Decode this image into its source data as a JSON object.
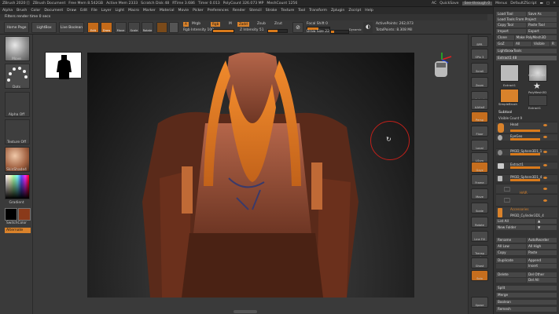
{
  "titlebar": {
    "items": [
      "ZBrush 2020 []",
      "ZBrush Document",
      "Free Mem 8.542GB",
      "Active Mem 2333",
      "Scratch Disk 48",
      "RTime 3.686",
      "Timer 0.013",
      "PolyCount 326.073 MP",
      "MeshCount 1256"
    ],
    "right": {
      "ac": "AC",
      "quicksave": "QuickSave",
      "seethrough": "See-through 0",
      "menus": "Menus",
      "script": "DefaultZScript"
    }
  },
  "menubar": [
    "Alpha",
    "Brush",
    "Color",
    "Document",
    "Draw",
    "Edit",
    "File",
    "Layer",
    "Light",
    "Macro",
    "Marker",
    "Material",
    "Movie",
    "Picker",
    "Preferences",
    "Render",
    "Stencil",
    "Stroke",
    "Texture",
    "Tool",
    "Transform",
    "Zplugin",
    "Zscript",
    "Help"
  ],
  "notebar": "Filters render time 0 secs",
  "toolbar": {
    "home_page": "Home Page",
    "lightbox": "LightBox",
    "live_boolean": "Live Boolean",
    "edit": "Edit",
    "draw": "Draw",
    "move": "Move",
    "scale": "Scale",
    "rotate": "Rotate",
    "a_label": "A",
    "mrgb": "Mrgb",
    "rgb": "Rgb",
    "m": "M",
    "zadd": "Zadd",
    "zsub": "Zsub",
    "zcut": "Zcut",
    "rgb_intensity_label": "Rgb Intensity",
    "rgb_intensity_value": "100",
    "z_intensity_label": "Z Intensity",
    "z_intensity_value": "51",
    "focal_shift_label": "Focal Shift",
    "focal_shift_value": "0",
    "draw_size_label": "Draw Size",
    "draw_size_value": "22",
    "dynamic": "Dynamic",
    "active_points_label": "ActivePoints:",
    "active_points_value": "262,073",
    "total_points_label": "TotalPoints:",
    "total_points_value": "8.308 Mil"
  },
  "left_shelf": {
    "brush_label": "Move",
    "stroke_label": "Dots",
    "alpha_label": "Alpha Off",
    "texture_label": "Texture Off",
    "material_label": "SkinShade4",
    "gradient_label": "Gradient",
    "switch_color_label": "SwitchColor",
    "alternate_label": "Alternate",
    "main_color": "#ffffff",
    "secondary_color": "#8a3a1a"
  },
  "right_shelf": [
    {
      "label": "BPR",
      "active": false
    },
    {
      "label": "SPix 3",
      "active": false
    },
    {
      "label": "Scroll",
      "active": false
    },
    {
      "label": "Zoom",
      "active": false
    },
    {
      "label": "Actual",
      "active": false
    },
    {
      "label": "AAHalf",
      "active": false
    },
    {
      "label": "Persp",
      "active": true
    },
    {
      "label": "Floor",
      "active": false
    },
    {
      "label": "Local",
      "active": false
    },
    {
      "label": "LSym",
      "active": false
    },
    {
      "label": "Gxyz",
      "active": true
    },
    {
      "label": "Frame",
      "active": false
    },
    {
      "label": "Move",
      "active": false
    },
    {
      "label": "Scale",
      "active": false
    },
    {
      "label": "Rotate",
      "active": false
    },
    {
      "label": "Line Fill PolyF",
      "active": false
    },
    {
      "label": "Transp",
      "active": false
    },
    {
      "label": "Ghost",
      "active": false
    },
    {
      "label": "Solo",
      "active": true
    },
    {
      "label": "Xpose",
      "active": false
    }
  ],
  "tool_tray": {
    "load_tool": "Load Tool",
    "save_as": "Save As",
    "load_tools_from_project": "Load Tools From Project",
    "copy_tool": "Copy Tool",
    "paste_tool": "Paste Tool",
    "import": "Import",
    "export": "Export",
    "clone": "Clone",
    "make_polymesh3d": "Make PolyMesh3D",
    "goz": "GoZ",
    "all": "All",
    "visible": "Visible",
    "r": "R",
    "lightbox_tools": "Lightbox▸Tools",
    "current_tool_label": "Extract1",
    "current_tool_value": "48",
    "tools": [
      {
        "name": "Extract1",
        "shape": "torso"
      },
      {
        "name": "Cylinder3D",
        "shape": "cylinder"
      },
      {
        "name": "PolyMesh3D",
        "shape": "star"
      },
      {
        "name": "SimpleBrush",
        "shape": "brush"
      },
      {
        "name": "Extract1",
        "shape": "torso2"
      }
    ],
    "subtool_header": "Subtool",
    "visible_count": "Visible Count 9",
    "subtools": [
      {
        "name": "Head",
        "kind": "head"
      },
      {
        "name": "EyeGeo",
        "kind": "eye"
      },
      {
        "name": "PM3D_Sphere3D1_1",
        "kind": "sphere"
      },
      {
        "name": "Extract1",
        "kind": "torso"
      },
      {
        "name": "PM3D_Sphere3D1_4",
        "kind": "sphere"
      }
    ],
    "folders": [
      "",
      "HAIR",
      "Accessories"
    ],
    "last_subtool": "PM3D_Cylinder3D1_4",
    "list_all": "List All",
    "new_folder": "New Folder",
    "buttons": {
      "rename": "Rename",
      "autoreorder": "AutoReorder",
      "all_low": "All Low",
      "all_high": "All High",
      "copy": "Copy",
      "paste": "Paste",
      "duplicate": "Duplicate",
      "append": "Append",
      "insert": "Insert",
      "delete": "Delete",
      "del_other": "Del Other",
      "del_all": "Del All",
      "split": "Split",
      "merge": "Merge",
      "boolean": "Boolean",
      "remesh": "Remesh"
    }
  },
  "colors": {
    "accent": "#d9822b",
    "panel": "#3a3a3a",
    "dark": "#262626"
  }
}
